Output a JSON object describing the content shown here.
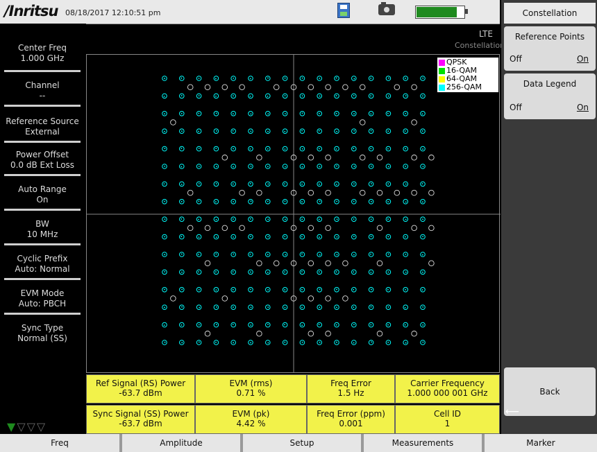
{
  "status_bar": {
    "brand": "/Inritsu",
    "datetime": "08/18/2017 12:10:51 pm",
    "battery_level": 0.85,
    "icons": [
      "save-icon",
      "camera-icon",
      "battery-icon"
    ]
  },
  "header": {
    "mode": "LTE",
    "view": "Constellation"
  },
  "left_params": [
    {
      "label": "Center Freq",
      "value": "1.000 GHz"
    },
    {
      "label": "Channel",
      "value": "--"
    },
    {
      "label": "Reference Source",
      "value": "External"
    },
    {
      "label": "Power Offset",
      "value": "0.0 dB Ext Loss"
    },
    {
      "label": "Auto Range",
      "value": "On"
    },
    {
      "label": "BW",
      "value": "10 MHz"
    },
    {
      "label": "Cyclic Prefix",
      "value": "Auto: Normal"
    },
    {
      "label": "EVM Mode",
      "value": "Auto: PBCH"
    },
    {
      "label": "Sync Type",
      "value": "Normal (SS)"
    }
  ],
  "legend": [
    {
      "label": "QPSK",
      "color": "#ff00ff"
    },
    {
      "label": "16-QAM",
      "color": "#00e000"
    },
    {
      "label": "64-QAM",
      "color": "#ffff00"
    },
    {
      "label": "256-QAM",
      "color": "#00ffff"
    }
  ],
  "measurements": [
    {
      "label": "Ref Signal (RS) Power",
      "value": "-63.7 dBm"
    },
    {
      "label": "EVM (rms)",
      "value": "0.71 %"
    },
    {
      "label": "Freq Error",
      "value": "1.5 Hz"
    },
    {
      "label": "Carrier Frequency",
      "value": "1.000 000 001 GHz"
    },
    {
      "label": "Sync Signal (SS) Power",
      "value": "-63.7 dBm"
    },
    {
      "label": "EVM (pk)",
      "value": "4.42 %"
    },
    {
      "label": "Freq Error (ppm)",
      "value": "0.001"
    },
    {
      "label": "Cell ID",
      "value": "1"
    }
  ],
  "right_menu": {
    "title": "Constellation",
    "reference_points": {
      "label": "Reference Points",
      "off": "Off",
      "on": "On"
    },
    "data_legend": {
      "label": "Data Legend",
      "off": "Off",
      "on": "On"
    },
    "back": "Back"
  },
  "bottom_menu": [
    "Freq",
    "Amplitude",
    "Setup",
    "Measurements",
    "Marker"
  ],
  "chart_data": {
    "type": "scatter",
    "title": "",
    "constellation": "64-QAM",
    "grid": "8x8 per quadrant",
    "reference_points": true,
    "axes_crosshair": true,
    "series": [
      {
        "name": "64-QAM",
        "color": "#00ffff",
        "symbols_per_axis": 16
      }
    ]
  }
}
